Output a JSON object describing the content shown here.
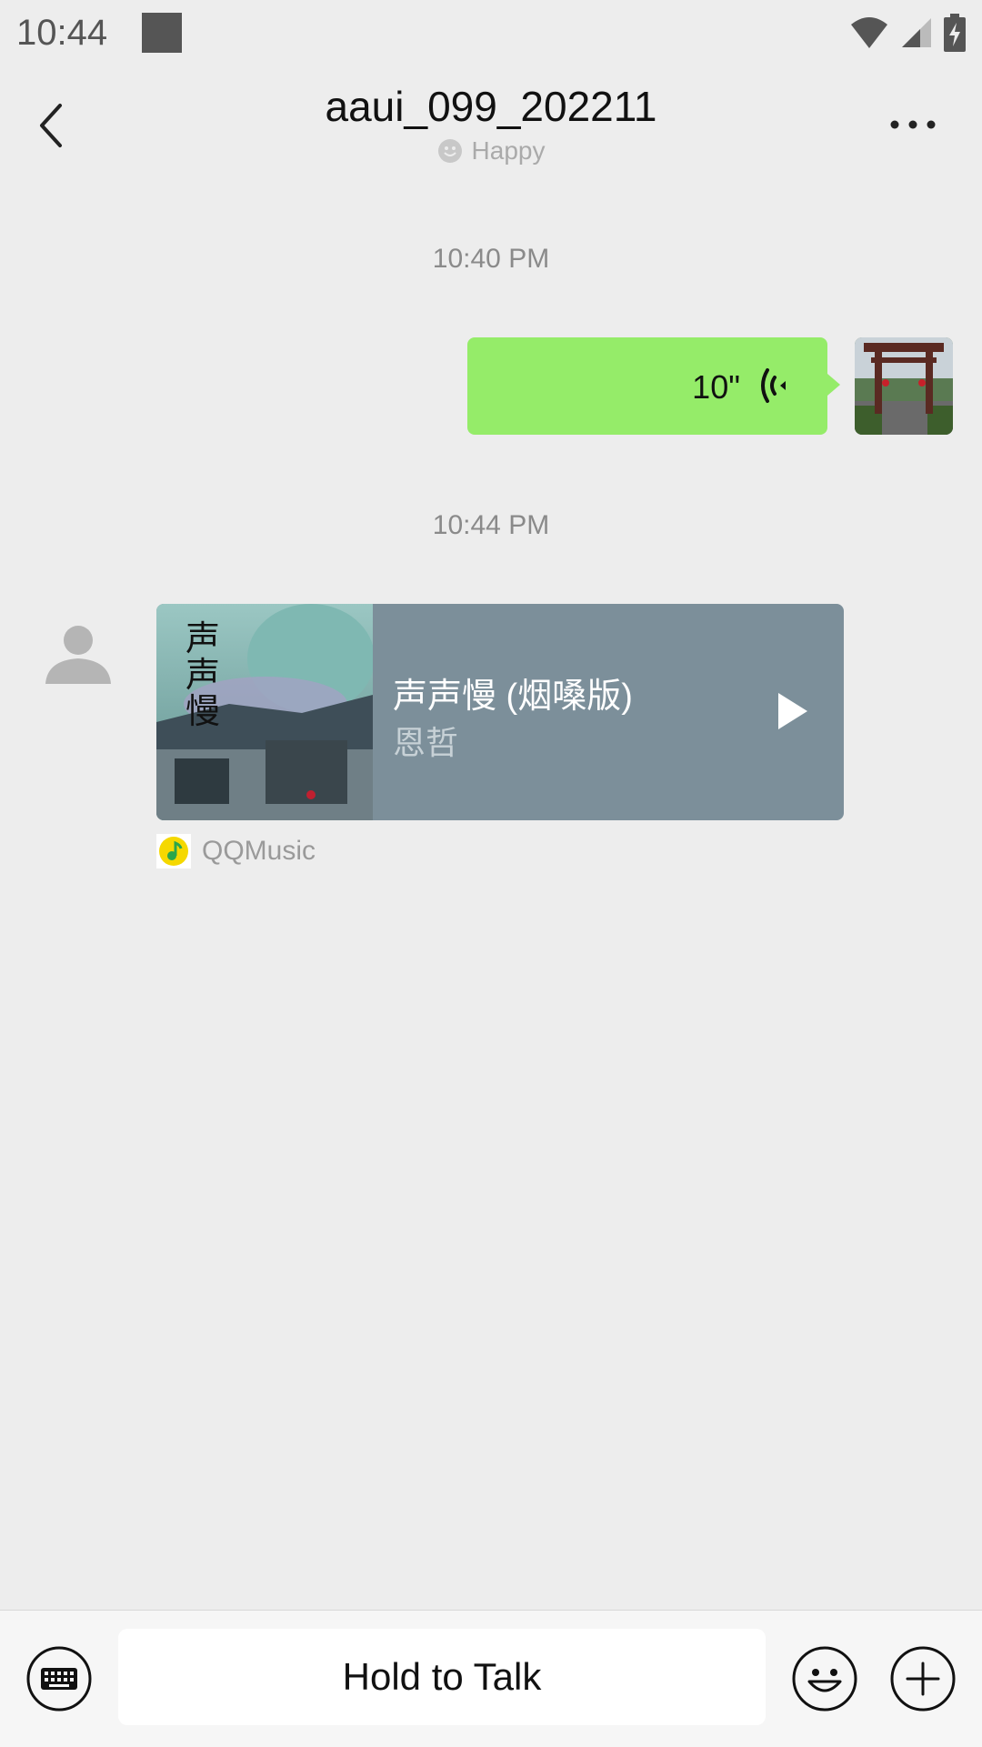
{
  "status_bar": {
    "time": "10:44",
    "icons": [
      "notification-square-icon",
      "wifi-icon",
      "signal-icon",
      "battery-charging-icon"
    ]
  },
  "header": {
    "title": "aaui_099_202211",
    "status": "Happy",
    "back_icon": "chevron-left-icon",
    "more_icon": "more-dots-icon"
  },
  "messages": [
    {
      "timestamp": "10:40 PM",
      "type": "voice",
      "sender": "self",
      "duration": "10\"",
      "bubble_color": "#95ec69"
    },
    {
      "timestamp": "10:44 PM",
      "type": "music",
      "sender": "other",
      "song_title": "声声慢 (烟嗓版)",
      "artist": "恩哲",
      "album_cover_text": "声声慢",
      "source": "QQMusic",
      "card_color": "#7c8f9a"
    }
  ],
  "input_bar": {
    "hold_to_talk": "Hold to Talk",
    "icons": [
      "keyboard-icon",
      "emoji-icon",
      "plus-icon"
    ]
  }
}
